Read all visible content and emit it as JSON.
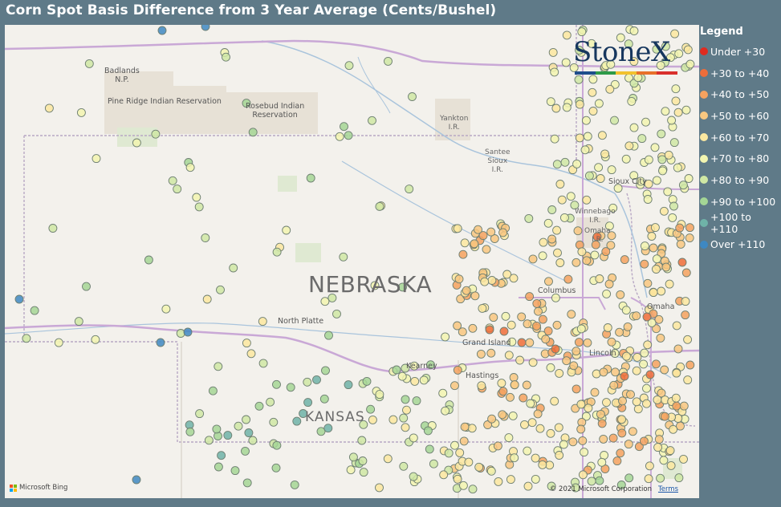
{
  "title": "Corn Spot Basis Difference from 3 Year Average (Cents/Bushel)",
  "map": {
    "state_label": "NEBRASKA",
    "state_label_2": "KANSAS",
    "places": [
      {
        "id": "badlands",
        "text": "Badlands\nN.P."
      },
      {
        "id": "pineridge",
        "text": "Pine Ridge Indian Reservation"
      },
      {
        "id": "rosebud",
        "text": "Rosebud Indian\nReservation"
      },
      {
        "id": "yankton",
        "text": "Yankton\nI.R."
      },
      {
        "id": "santee",
        "text": "Santee\nSioux\nI.R."
      },
      {
        "id": "siouxcity",
        "text": "Sioux City"
      },
      {
        "id": "winnebago",
        "text": "Winnebago\nI.R."
      },
      {
        "id": "omahair",
        "text": "Omaha\nI.R."
      },
      {
        "id": "columbus",
        "text": "Columbus"
      },
      {
        "id": "omaha",
        "text": "Omaha"
      },
      {
        "id": "northplatte",
        "text": "North Platte"
      },
      {
        "id": "grandisland",
        "text": "Grand Island"
      },
      {
        "id": "kearney",
        "text": "Kearney"
      },
      {
        "id": "hastings",
        "text": "Hastings"
      },
      {
        "id": "lincoln",
        "text": "Lincoln"
      }
    ],
    "attribution_left": "Microsoft Bing",
    "attribution_right": "© 2021 Microsoft Corporation",
    "terms": "Terms"
  },
  "logo": {
    "text": "StoneX",
    "colors": [
      "#1f4e8c",
      "#2e9a48",
      "#f2c12e",
      "#e8702a",
      "#d9302c"
    ]
  },
  "legend": {
    "title": "Legend",
    "items": [
      {
        "label": "Under +30",
        "color": "#e02b20"
      },
      {
        "label": "+30 to +40",
        "color": "#ee6d3a"
      },
      {
        "label": "+40 to +50",
        "color": "#f5a25f"
      },
      {
        "label": "+50 to +60",
        "color": "#f8c780"
      },
      {
        "label": "+60 to +70",
        "color": "#fbe8a0"
      },
      {
        "label": "+70 to +80",
        "color": "#f2f5b0"
      },
      {
        "label": "+80 to +90",
        "color": "#cfe8a4"
      },
      {
        "label": "+90 to +100",
        "color": "#a4d695"
      },
      {
        "label": "+100 to +110",
        "color": "#6fb3a8"
      },
      {
        "label": "Over +110",
        "color": "#3e88c2"
      }
    ]
  }
}
